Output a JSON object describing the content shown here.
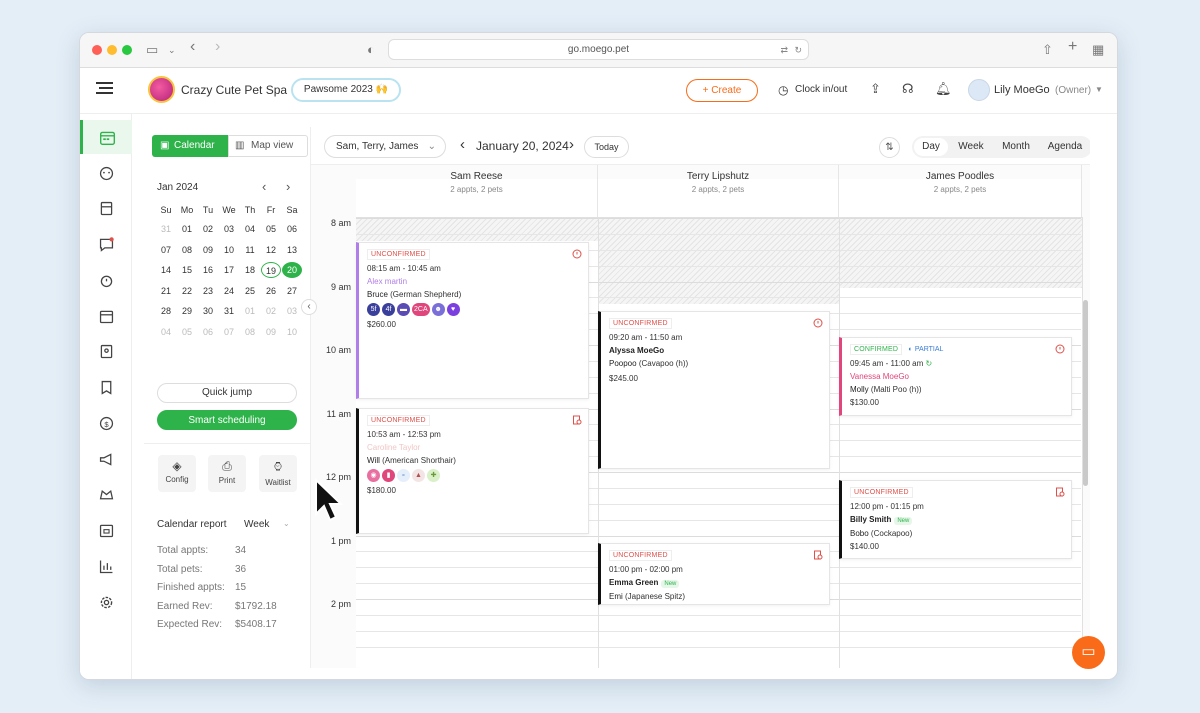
{
  "browser": {
    "url": "go.moego.pet"
  },
  "header": {
    "business_name": "Crazy Cute Pet Spa",
    "promo_label": "Pawsome 2023 🙌",
    "create_label": "+ Create",
    "clock_label": "Clock in/out",
    "user_name": "Lily MoeGo",
    "user_role": "(Owner)"
  },
  "toolbar": {
    "calendar_tab": "Calendar",
    "map_tab": "Map view",
    "staff_select": "Sam, Terry, James",
    "date": "January 20, 2024",
    "today": "Today",
    "views": [
      "Day",
      "Week",
      "Month",
      "Agenda"
    ],
    "active_view": "Day"
  },
  "mini_calendar": {
    "month": "Jan 2024",
    "dow": [
      "Su",
      "Mo",
      "Tu",
      "We",
      "Th",
      "Fr",
      "Sa"
    ],
    "weeks": [
      [
        "31",
        "01",
        "02",
        "03",
        "04",
        "05",
        "06"
      ],
      [
        "07",
        "08",
        "09",
        "10",
        "11",
        "12",
        "13"
      ],
      [
        "14",
        "15",
        "16",
        "17",
        "18",
        "19",
        "20"
      ],
      [
        "21",
        "22",
        "23",
        "24",
        "25",
        "26",
        "27"
      ],
      [
        "28",
        "29",
        "30",
        "31",
        "01",
        "02",
        "03"
      ],
      [
        "04",
        "05",
        "06",
        "07",
        "08",
        "09",
        "10"
      ]
    ],
    "today": "19",
    "selected": "20"
  },
  "panel": {
    "quick_jump": "Quick jump",
    "smart_scheduling": "Smart scheduling",
    "config": "Config",
    "print": "Print",
    "waitlist": "Waitlist",
    "report_title": "Calendar report",
    "report_period": "Week",
    "report": [
      {
        "label": "Total appts:",
        "value": "34"
      },
      {
        "label": "Total pets:",
        "value": "36"
      },
      {
        "label": "Finished appts:",
        "value": "15"
      },
      {
        "label": "Earned Rev:",
        "value": "$1792.18"
      },
      {
        "label": "Expected Rev:",
        "value": "$5408.17"
      }
    ]
  },
  "columns": [
    {
      "name": "Sam Reese",
      "summary": "2 appts, 2 pets"
    },
    {
      "name": "Terry Lipshutz",
      "summary": "2 appts, 2 pets"
    },
    {
      "name": "James Poodles",
      "summary": "2 appts, 2 pets"
    }
  ],
  "hours": [
    "8 am",
    "9 am",
    "10 am",
    "11 am",
    "12 pm",
    "1 pm",
    "2 pm"
  ],
  "appointments": [
    {
      "status": "UNCONFIRMED",
      "time": "08:15 am - 10:45 am",
      "client": "Alex martin",
      "pet": "Bruce",
      "breed": "(German Shepherd)",
      "price": "$260.00",
      "badges": [
        "5f",
        "4f",
        "",
        "2CA",
        "",
        ""
      ]
    },
    {
      "status": "UNCONFIRMED",
      "time": "10:53 am - 12:53 pm",
      "client": "Caroline Taylor",
      "pet": "Will",
      "breed": "(American Shorthair)",
      "price": "$180.00"
    },
    {
      "status": "UNCONFIRMED",
      "time": "09:20 am - 11:50 am",
      "client": "Alyssa MoeGo",
      "pet": "Poopoo",
      "breed": "(Cavapoo (h))",
      "price": "$245.00"
    },
    {
      "status": "UNCONFIRMED",
      "time": "01:00 pm - 02:00 pm",
      "client": "Emma Green",
      "client_tag": "New",
      "pet": "Emi",
      "breed": "(Japanese Spitz)"
    },
    {
      "status": "CONFIRMED",
      "extra_status": "PARTIAL",
      "time": "09:45 am - 11:00 am",
      "client": "Vanessa MoeGo",
      "pet": "Molly",
      "breed": "(Malti Poo (h))",
      "price": "$130.00"
    },
    {
      "status": "UNCONFIRMED",
      "time": "12:00 pm - 01:15 pm",
      "client": "Billy Smith",
      "client_tag": "New",
      "pet": "Bobo",
      "breed": "(Cockapoo)",
      "price": "$140.00"
    }
  ],
  "colors": {
    "brand": "#f96b18",
    "green": "#2db34a",
    "purple": "#b07ee8",
    "pink": "#e0457b",
    "red": "#e0504a"
  }
}
